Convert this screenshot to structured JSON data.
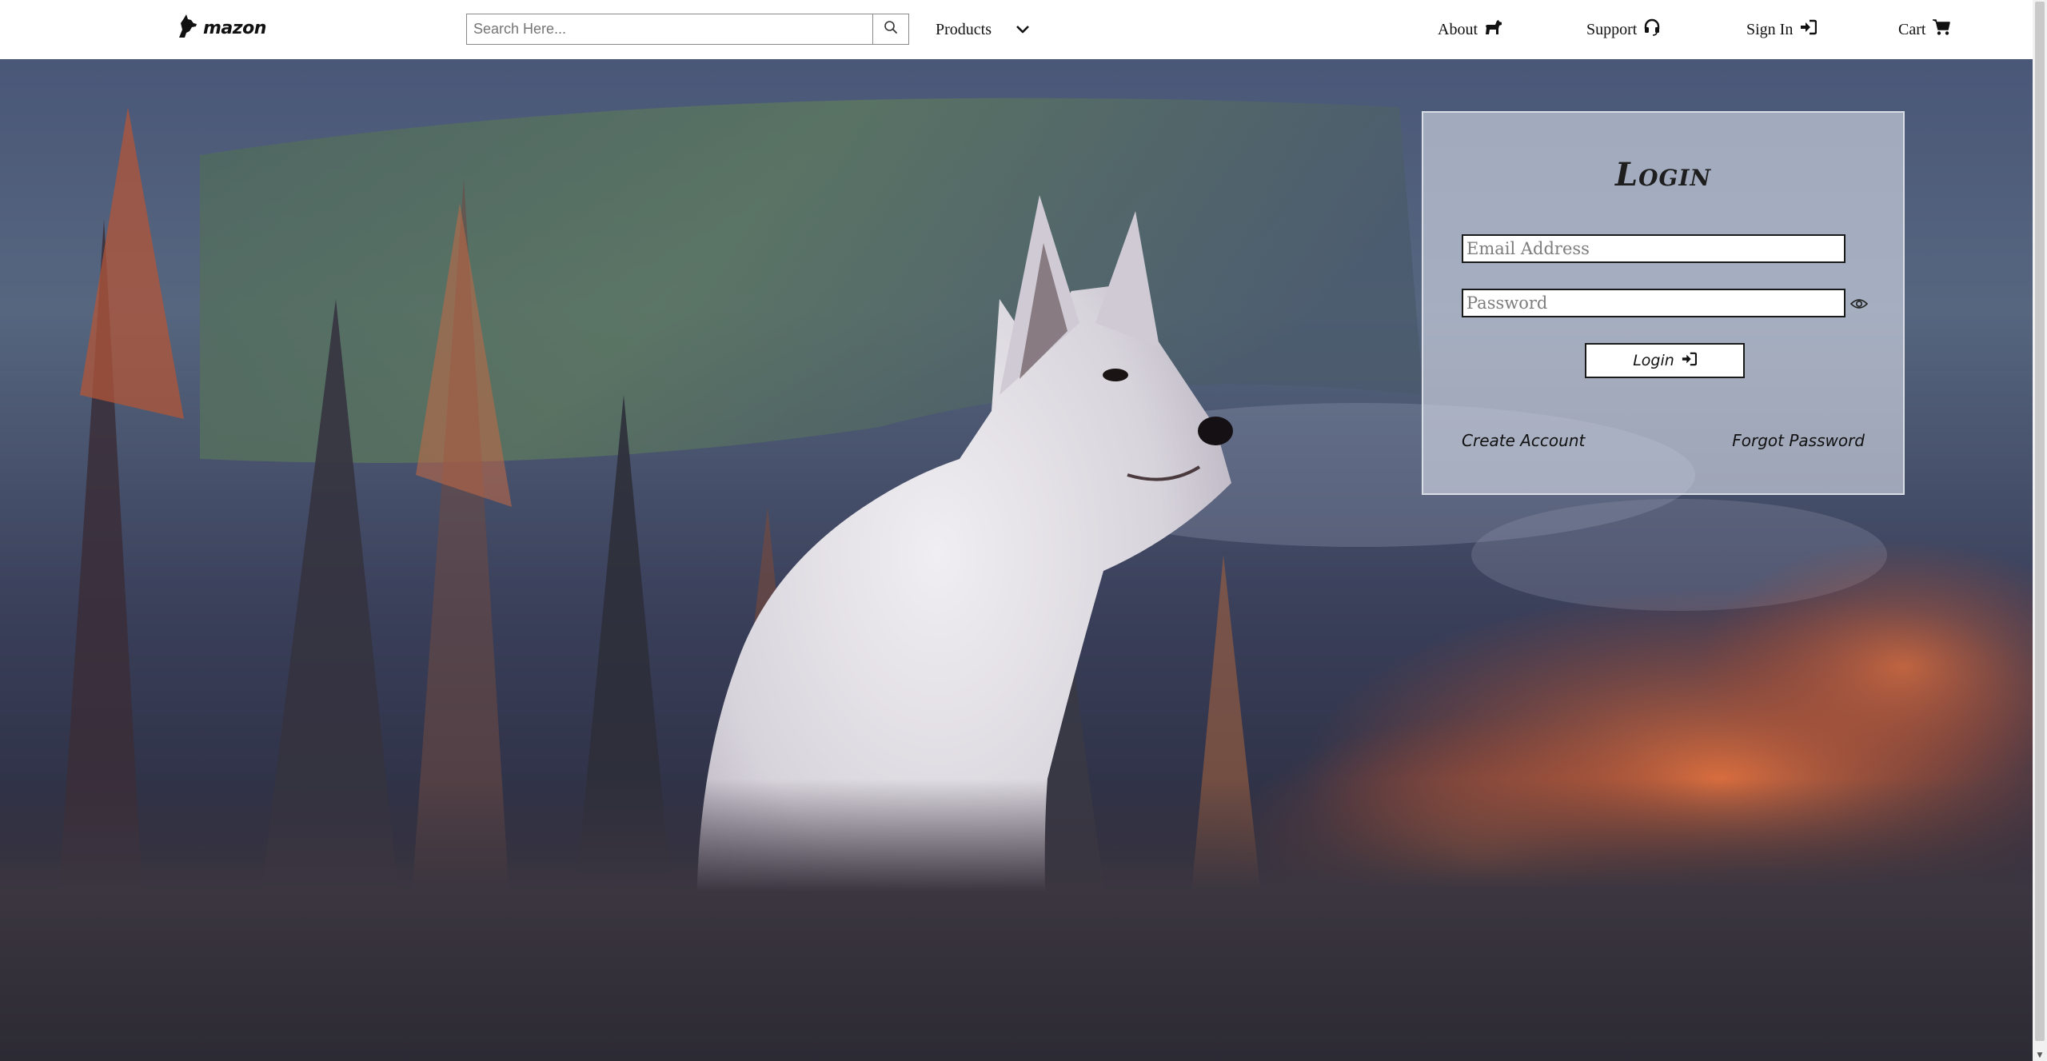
{
  "header": {
    "logo_text": "mazon",
    "search": {
      "placeholder": "Search Here...",
      "value": ""
    },
    "nav": {
      "products": "Products",
      "about": "About",
      "support": "Support",
      "sign_in": "Sign In",
      "cart": "Cart"
    }
  },
  "login": {
    "title": "Login",
    "email_placeholder": "Email Address",
    "password_placeholder": "Password",
    "button_label": "Login",
    "create_account": "Create Account",
    "forgot_password": "Forgot Password"
  },
  "icons": {
    "logo": "dog-logo-icon",
    "search": "search-icon",
    "products": "chevron-down-icon",
    "about": "dog-icon",
    "support": "headset-icon",
    "sign_in": "sign-in-icon",
    "cart": "cart-icon",
    "password_toggle": "eye-icon",
    "login_button": "sign-in-icon"
  },
  "colors": {
    "navbar_bg": "#ffffff",
    "card_bg": "#d6dce8",
    "text": "#111111"
  }
}
